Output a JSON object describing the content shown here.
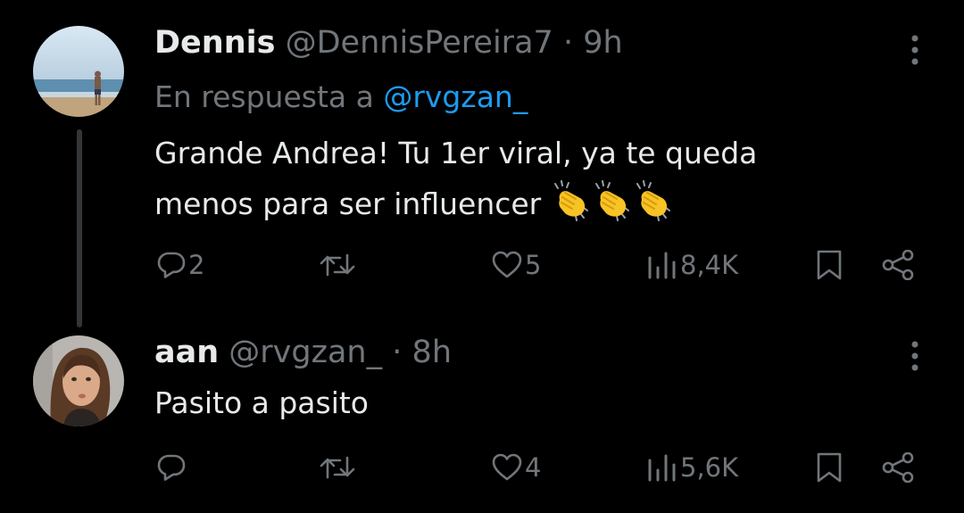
{
  "tweets": [
    {
      "name": "Dennis",
      "handle": "@DennisPereira7",
      "separator": "·",
      "time": "9h",
      "reply_prefix": "En respuesta a",
      "reply_mention": "@rvgzan_",
      "text_line1": "Grande Andrea! Tu 1er viral, ya te queda",
      "text_line2": "menos para ser influencer",
      "emoji": [
        "clapping-hands",
        "clapping-hands",
        "clapping-hands"
      ],
      "replies": "2",
      "reposts": "",
      "likes": "5",
      "views": "8,4K",
      "avatar": "beach-photo"
    },
    {
      "name": "aan",
      "handle": "@rvgzan_",
      "separator": "·",
      "time": "8h",
      "text_line1": "Pasito a pasito",
      "replies": "",
      "reposts": "",
      "likes": "4",
      "views": "5,6K",
      "avatar": "woman-portrait"
    }
  ],
  "colors": {
    "background": "#000000",
    "primary_text": "#e7e9ea",
    "secondary_text": "#71767b",
    "mention": "#1d9bf0",
    "thread_line": "#333639",
    "emoji_yellow": "#f7c325"
  },
  "icons": [
    "more-icon",
    "reply-icon",
    "repost-icon",
    "like-icon",
    "views-icon",
    "bookmark-icon",
    "share-icon"
  ]
}
